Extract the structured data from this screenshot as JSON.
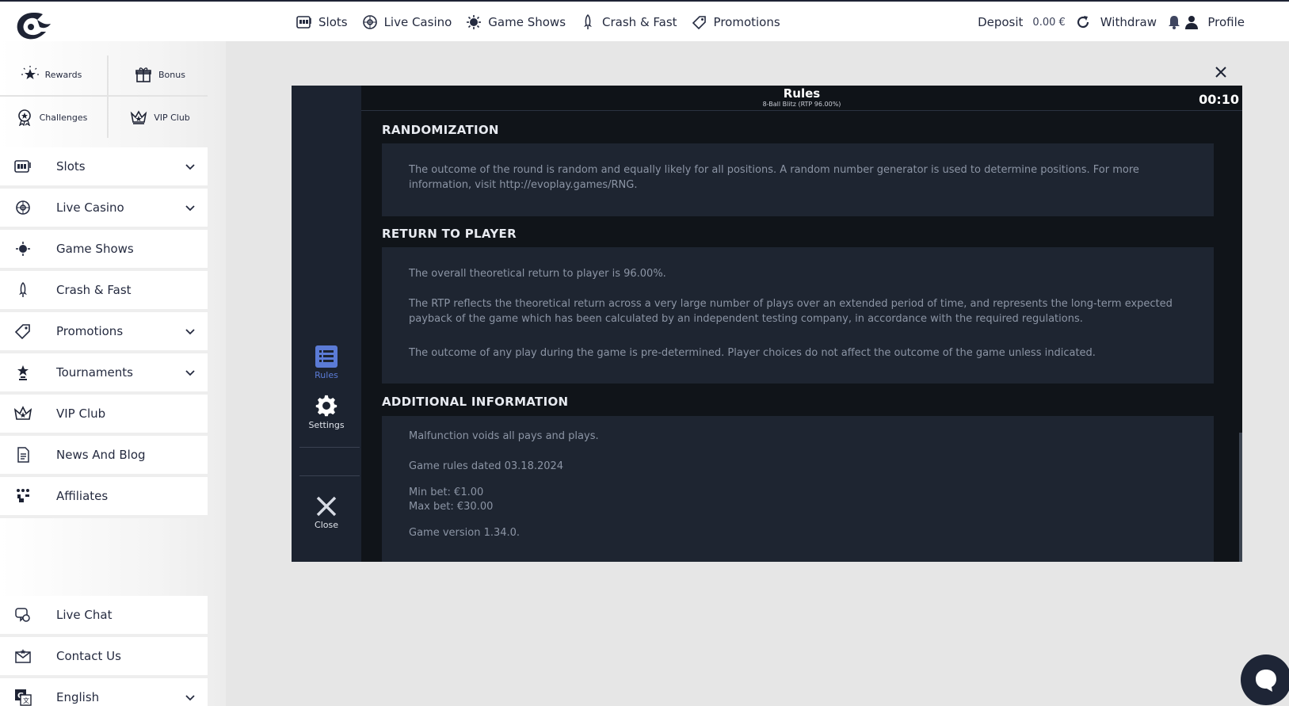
{
  "nav": {
    "items": [
      {
        "label": "Slots",
        "icon": "slot-machine-icon"
      },
      {
        "label": "Live Casino",
        "icon": "roulette-icon"
      },
      {
        "label": "Game Shows",
        "icon": "wheel-icon"
      },
      {
        "label": "Crash & Fast",
        "icon": "rocket-icon"
      },
      {
        "label": "Promotions",
        "icon": "tag-icon"
      }
    ]
  },
  "account": {
    "deposit_label": "Deposit",
    "balance": "0.00 €",
    "withdraw_label": "Withdraw",
    "profile_label": "Profile"
  },
  "sidebar": {
    "quick": [
      {
        "label": "Rewards",
        "icon": "star-burst-icon"
      },
      {
        "label": "Bonus",
        "icon": "gift-icon"
      },
      {
        "label": "Challenges",
        "icon": "badge-icon"
      },
      {
        "label": "VIP Club",
        "icon": "crown-icon"
      }
    ],
    "items": [
      {
        "label": "Slots",
        "icon": "slot-machine-icon",
        "expandable": true
      },
      {
        "label": "Live Casino",
        "icon": "roulette-icon",
        "expandable": true
      },
      {
        "label": "Game Shows",
        "icon": "wheel-icon",
        "expandable": false
      },
      {
        "label": "Crash & Fast",
        "icon": "rocket-icon",
        "expandable": false
      },
      {
        "label": "Promotions",
        "icon": "tag-icon",
        "expandable": true
      },
      {
        "label": "Tournaments",
        "icon": "trophy-icon",
        "expandable": true
      },
      {
        "label": "VIP Club",
        "icon": "crown-icon",
        "expandable": false
      },
      {
        "label": "News And Blog",
        "icon": "document-icon",
        "expandable": false
      },
      {
        "label": "Affiliates",
        "icon": "people-icon",
        "expandable": false
      }
    ],
    "support": [
      {
        "label": "Live Chat",
        "icon": "chat-icon",
        "expandable": false
      },
      {
        "label": "Contact Us",
        "icon": "envelope-icon",
        "expandable": false
      },
      {
        "label": "English",
        "icon": "translate-icon",
        "expandable": true
      }
    ]
  },
  "game": {
    "title": "Rules",
    "subtitle": "8-Ball Blitz (RTP 96.00%)",
    "timer": "00:10",
    "rail": {
      "rules_label": "Rules",
      "settings_label": "Settings",
      "close_label": "Close"
    },
    "sections": [
      {
        "title": "RANDOMIZATION",
        "paragraphs": [
          "The outcome of the round is random and equally likely for all positions. A random number generator is used to determine positions. For more information, visit http://evoplay.games/RNG."
        ]
      },
      {
        "title": "RETURN TO PLAYER",
        "paragraphs": [
          "The overall theoretical return to player is 96.00%.",
          "The RTP reflects the theoretical return across a very large number of plays over an extended period of time, and represents the long-term expected payback of the game which has been calculated by an independent testing company, in accordance with the required regulations.",
          "The outcome of any play during the game is pre-determined. Player choices do not affect the outcome of the game unless indicated."
        ]
      },
      {
        "title": "ADDITIONAL INFORMATION",
        "paragraphs": [
          "Malfunction voids all pays and plays.",
          "Game rules dated 03.18.2024",
          "Min bet: €1.00",
          "Max bet: €30.00",
          "Game version 1.34.0."
        ]
      }
    ]
  },
  "colors": {
    "brand_navy": "#1e2334",
    "rail_active": "#5b7bd6",
    "game_bg": "#101419",
    "section_bg": "#1e2531"
  }
}
